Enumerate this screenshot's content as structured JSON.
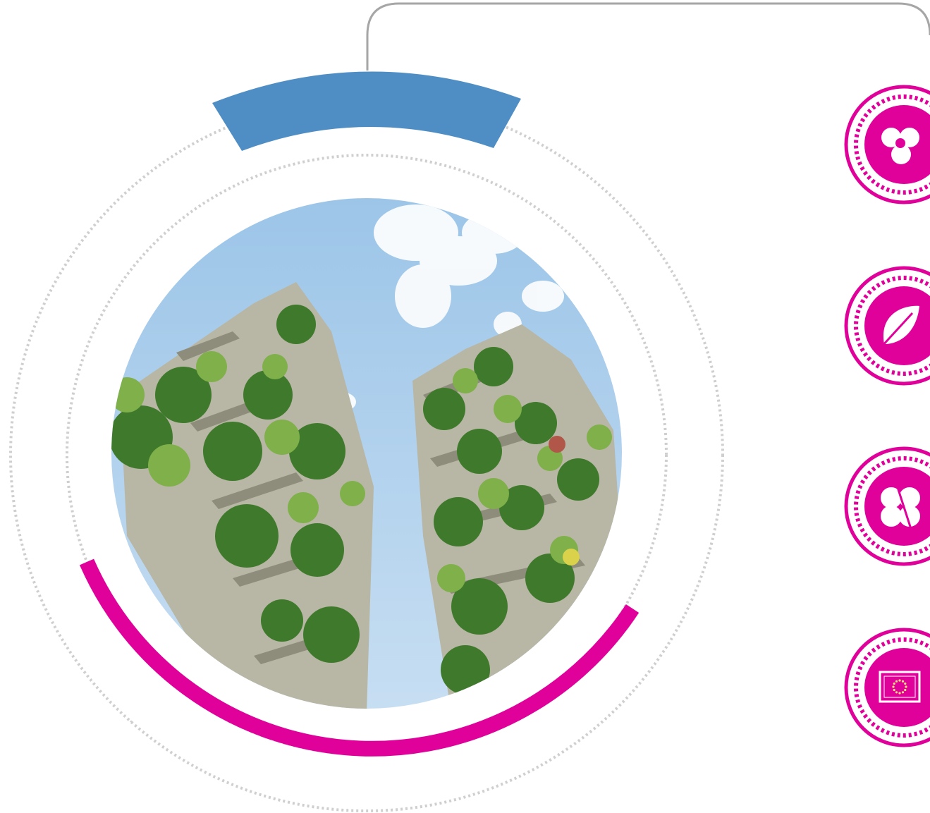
{
  "colors": {
    "background": "#ffffff",
    "accent_magenta": "#e0009a",
    "accent_blue": "#4f8ec4",
    "connector_gray": "#a6a6a6",
    "dotted_gray": "#cfcfcf",
    "sky_top": "#9cc5e8",
    "sky_bottom": "#c7def2",
    "foliage_dark": "#3f7a2c",
    "foliage_light": "#7fb04a",
    "building_concrete": "#b8b6a4"
  },
  "photo": {
    "subject": "vertical-forest-towers"
  },
  "icons": [
    {
      "name": "trefoil-icon"
    },
    {
      "name": "leaf-icon"
    },
    {
      "name": "clover-icon"
    },
    {
      "name": "eu-flag-icon"
    }
  ]
}
